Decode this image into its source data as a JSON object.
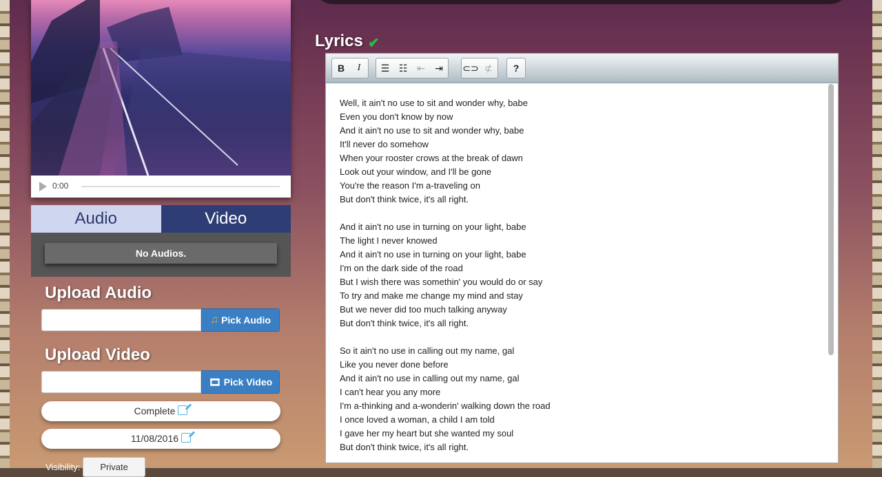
{
  "video_player": {
    "time": "0:00"
  },
  "media_tabs": {
    "audio": "Audio",
    "video": "Video"
  },
  "audio_panel": {
    "empty_text": "No Audios."
  },
  "upload_audio": {
    "title": "Upload Audio",
    "button": "Pick Audio",
    "value": ""
  },
  "upload_video": {
    "title": "Upload Video",
    "button": "Pick Video",
    "value": ""
  },
  "status": {
    "label": "Complete"
  },
  "date": {
    "label": "11/08/2016"
  },
  "visibility": {
    "label": "Visibility:",
    "value": "Private"
  },
  "lyrics": {
    "title": "Lyrics",
    "toolbar": {
      "bold": "B",
      "italic": "I",
      "help": "?"
    },
    "lines": [
      "Well, it ain't no use to sit and wonder why, babe",
      "Even you don't know by now",
      "And it ain't no use to sit and wonder why, babe",
      "It'll never do somehow",
      "When your rooster crows at the break of dawn",
      "Look out your window, and I'll be gone",
      "You're the reason I'm a-traveling on",
      "But don't think twice, it's all right.",
      "",
      "And it ain't no use in turning on your light, babe",
      "The light I never knowed",
      "And it ain't no use in turning on your light, babe",
      "I'm on the dark side of the road",
      "But I wish there was somethin' you would do or say",
      "To try and make me change my mind and stay",
      "But we never did too much talking anyway",
      "But don't think twice, it's all right.",
      "",
      "So it ain't no use in calling out my name, gal",
      "Like you never done before",
      "And it ain't no use in calling out my name, gal",
      "I can't hear you any more",
      "I'm a-thinking and a-wonderin' walking down the road",
      "I once loved a woman, a child I am told",
      "I gave her my heart but she wanted my soul",
      "But don't think twice, it's all right."
    ]
  }
}
